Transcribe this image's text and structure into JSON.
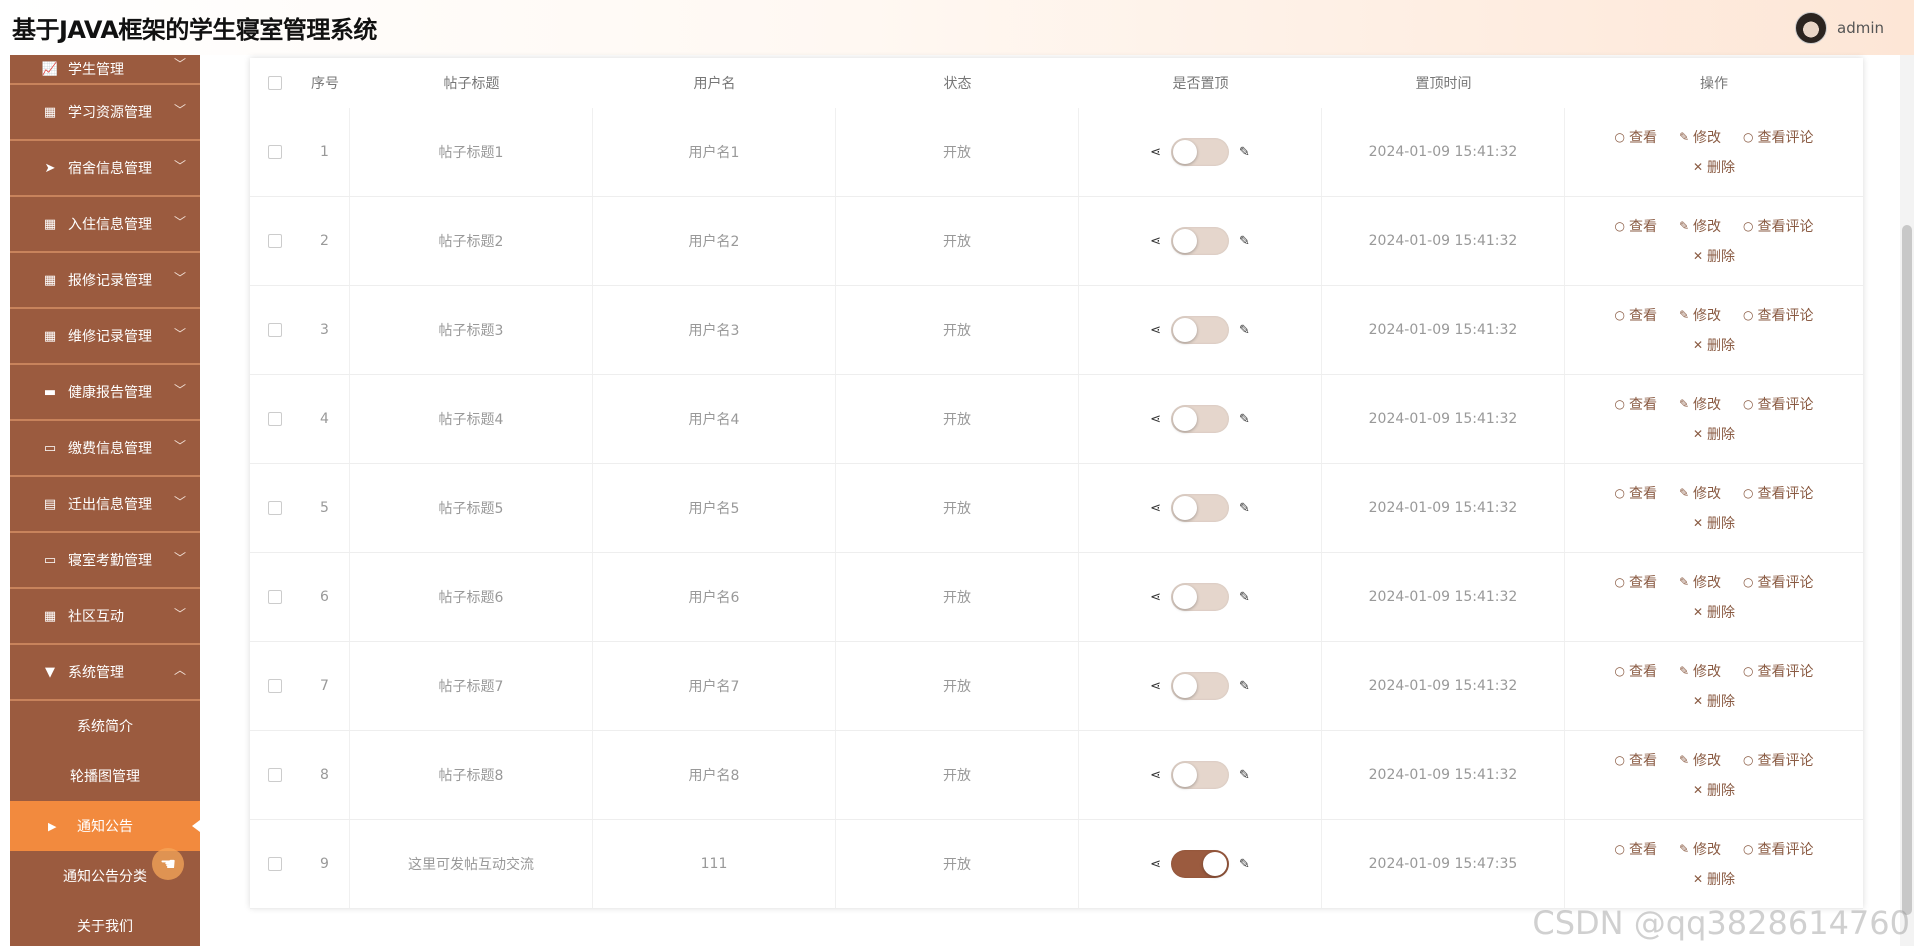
{
  "header": {
    "app_title": "基于JAVA框架的学生寝室管理系统",
    "user_name": "admin"
  },
  "sidebar": {
    "menus": [
      {
        "label": "学生管理",
        "icon": "chart-icon"
      },
      {
        "label": "学习资源管理",
        "icon": "grid-icon"
      },
      {
        "label": "宿舍信息管理",
        "icon": "send-icon"
      },
      {
        "label": "入住信息管理",
        "icon": "grid-icon"
      },
      {
        "label": "报修记录管理",
        "icon": "grid-icon"
      },
      {
        "label": "维修记录管理",
        "icon": "grid-icon"
      },
      {
        "label": "健康报告管理",
        "icon": "chat-icon"
      },
      {
        "label": "缴费信息管理",
        "icon": "monitor-icon"
      },
      {
        "label": "迁出信息管理",
        "icon": "clipboard-icon"
      },
      {
        "label": "寝室考勤管理",
        "icon": "monitor-icon"
      },
      {
        "label": "社区互动",
        "icon": "grid-icon"
      },
      {
        "label": "系统管理",
        "icon": "stand-icon"
      }
    ],
    "submenu": [
      "系统简介",
      "轮播图管理",
      "通知公告",
      "通知公告分类",
      "关于我们"
    ],
    "active_submenu": "通知公告"
  },
  "table": {
    "columns": [
      "序号",
      "帖子标题",
      "用户名",
      "状态",
      "是否置顶",
      "置顶时间",
      "操作"
    ],
    "rows": [
      {
        "idx": "1",
        "title": "帖子标题1",
        "user": "用户名1",
        "status": "开放",
        "top": false,
        "time": "2024-01-09 15:41:32"
      },
      {
        "idx": "2",
        "title": "帖子标题2",
        "user": "用户名2",
        "status": "开放",
        "top": false,
        "time": "2024-01-09 15:41:32"
      },
      {
        "idx": "3",
        "title": "帖子标题3",
        "user": "用户名3",
        "status": "开放",
        "top": false,
        "time": "2024-01-09 15:41:32"
      },
      {
        "idx": "4",
        "title": "帖子标题4",
        "user": "用户名4",
        "status": "开放",
        "top": false,
        "time": "2024-01-09 15:41:32"
      },
      {
        "idx": "5",
        "title": "帖子标题5",
        "user": "用户名5",
        "status": "开放",
        "top": false,
        "time": "2024-01-09 15:41:32"
      },
      {
        "idx": "6",
        "title": "帖子标题6",
        "user": "用户名6",
        "status": "开放",
        "top": false,
        "time": "2024-01-09 15:41:32"
      },
      {
        "idx": "7",
        "title": "帖子标题7",
        "user": "用户名7",
        "status": "开放",
        "top": false,
        "time": "2024-01-09 15:41:32"
      },
      {
        "idx": "8",
        "title": "帖子标题8",
        "user": "用户名8",
        "status": "开放",
        "top": false,
        "time": "2024-01-09 15:41:32"
      },
      {
        "idx": "9",
        "title": "这里可发帖互动交流",
        "user": "111",
        "status": "开放",
        "top": true,
        "time": "2024-01-09 15:47:35"
      }
    ],
    "actions": {
      "view": "查看",
      "edit": "修改",
      "comments": "查看评论",
      "delete": "删除"
    }
  },
  "watermark": "CSDN @qq3828614760",
  "colors": {
    "sidebar": "#9b5b3f",
    "active": "#f28a3e",
    "switch_on": "#9b5b3f"
  }
}
